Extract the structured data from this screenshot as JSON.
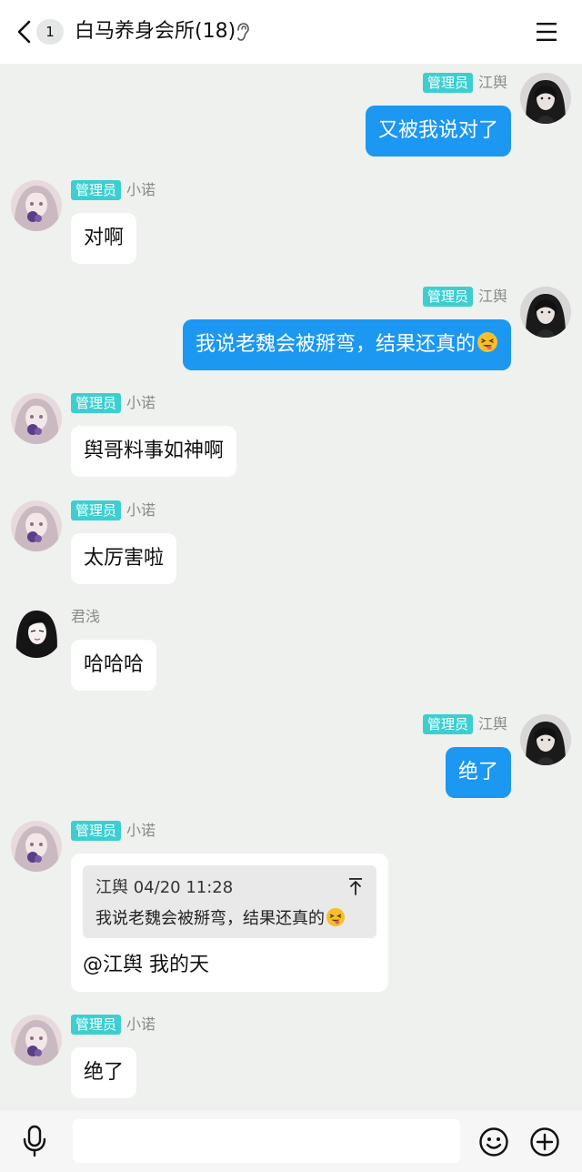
{
  "header": {
    "unread_count": "1",
    "title": "白马养身会所(18)"
  },
  "chat": {
    "messages": [
      {
        "side": "right",
        "role": "管理员",
        "name": "江舆",
        "text": "又被我说对了"
      },
      {
        "side": "left",
        "role": "管理员",
        "name": "小诺",
        "text": "对啊"
      },
      {
        "side": "right",
        "role": "管理员",
        "name": "江舆",
        "text": "我说老魏会被掰弯，结果还真的",
        "emoji": "squinting-tongue-emoji"
      },
      {
        "side": "left",
        "role": "管理员",
        "name": "小诺",
        "text": "舆哥料事如神啊"
      },
      {
        "side": "left",
        "role": "管理员",
        "name": "小诺",
        "text": "太厉害啦"
      },
      {
        "side": "left",
        "role": "",
        "name": "君浅",
        "text": "哈哈哈"
      },
      {
        "side": "right",
        "role": "管理员",
        "name": "江舆",
        "text": "绝了"
      },
      {
        "side": "left",
        "role": "管理员",
        "name": "小诺",
        "quote": {
          "author_time": "江舆 04/20 11:28",
          "text": "我说老魏会被掰弯，结果还真的",
          "emoji": "squinting-tongue-emoji"
        },
        "text": "@江舆 我的天"
      },
      {
        "side": "left",
        "role": "管理员",
        "name": "小诺",
        "text": "绝了"
      }
    ]
  },
  "input_bar": {
    "placeholder": "",
    "icons": [
      "microphone-icon",
      "smile-icon",
      "plus-icon"
    ]
  },
  "colors": {
    "chat_background": "#eef1ee",
    "own_bubble": "#1c97f2",
    "other_bubble": "#ffffff",
    "admin_badge": "#3dcfd0"
  }
}
